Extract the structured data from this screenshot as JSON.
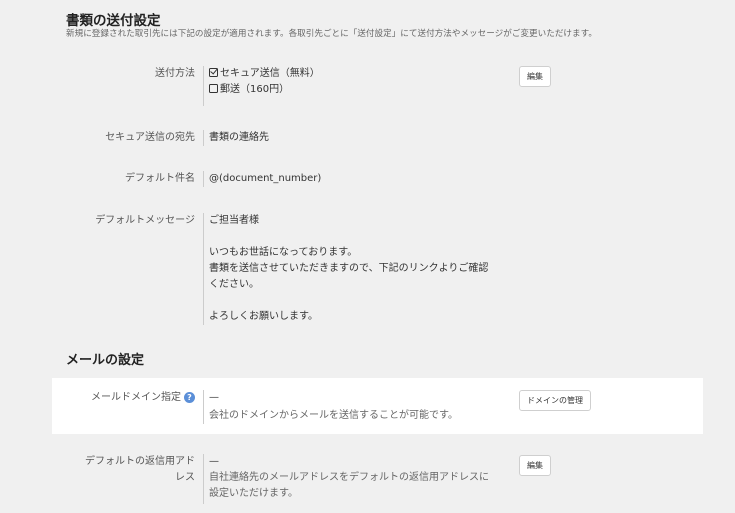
{
  "doc_settings": {
    "title": "書類の送付設定",
    "description": "新規に登録された取引先には下記の設定が適用されます。各取引先ごとに「送付設定」にて送付方法やメッセージがご変更いただけます。",
    "send_method": {
      "label": "送付方法",
      "options": [
        {
          "text": "セキュア送信（無料）",
          "checked": true
        },
        {
          "text": "郵送（160円）",
          "checked": false
        }
      ],
      "edit_button": "編集"
    },
    "secure_recipient": {
      "label": "セキュア送信の宛先",
      "value": "書類の連絡先"
    },
    "default_subject": {
      "label": "デフォルト件名",
      "value": "@(document_number)"
    },
    "default_message": {
      "label": "デフォルトメッセージ",
      "lines": [
        "ご担当者様",
        "",
        "いつもお世話になっております。",
        "書類を送信させていただきますので、下記のリンクよりご確認",
        "ください。",
        "",
        "よろしくお願いします。"
      ]
    }
  },
  "mail_settings": {
    "title": "メールの設定",
    "mail_domain": {
      "label": "メールドメイン指定",
      "help_icon": "?",
      "value": "—",
      "note": "会社のドメインからメールを送信することが可能です。",
      "manage_button": "ドメインの管理"
    },
    "default_reply": {
      "label_line1": "デフォルトの返信用アド",
      "label_line2": "レス",
      "value": "—",
      "note_line1": "自社連絡先のメールアドレスをデフォルトの返信用アドレスに",
      "note_line2": "設定いただけます。",
      "edit_button": "編集"
    }
  },
  "colors": {
    "help_icon": "#5b8fd8",
    "overlay": "rgba(0,0,0,0.06)"
  }
}
